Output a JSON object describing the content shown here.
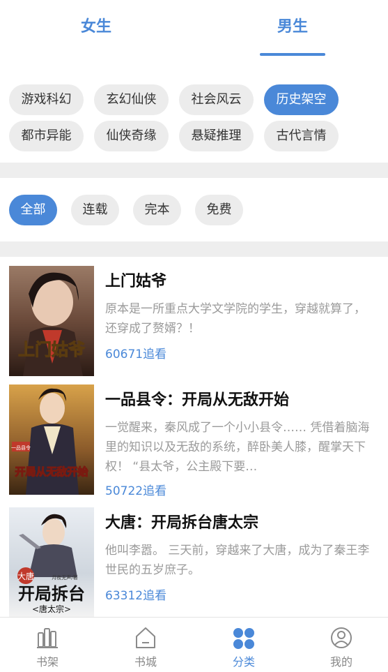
{
  "gender_tabs": {
    "female": "女生",
    "male": "男生",
    "active": "male"
  },
  "genres": [
    "游戏科幻",
    "玄幻仙侠",
    "社会风云",
    "历史架空",
    "都市异能",
    "仙侠奇缘",
    "悬疑推理",
    "古代言情"
  ],
  "genre_active": "历史架空",
  "filters": [
    "全部",
    "连载",
    "完本",
    "免费"
  ],
  "filter_active": "全部",
  "books": [
    {
      "title": "上门姑爷",
      "desc": "原本是一所重点大学文学院的学生，穿越就算了，还穿成了赘婿？！",
      "count": "60671追看",
      "cover_text": "上门姑爷"
    },
    {
      "title": "一品县令：开局从无敌开始",
      "desc": "一觉醒来，秦风成了一个小小县令…… 凭借着脑海里的知识以及无敌的系统，醉卧美人膝，醒掌天下权！ “县太爷，公主殿下要…",
      "count": "50722追看",
      "cover_text": "开局从无敌开始",
      "cover_tag": "一品县令"
    },
    {
      "title": "大唐：开局拆台唐太宗",
      "desc": "他叫李嚣。 三天前，穿越来了大唐，成为了秦王李世民的五岁庶子。",
      "count": "63312追看",
      "cover_text": "开局拆台",
      "cover_tag": "大唐",
      "cover_sub": "<唐太宗>",
      "cover_author": "月夜无声/著"
    }
  ],
  "bottom_nav": [
    {
      "label": "书架",
      "icon": "bookshelf-icon"
    },
    {
      "label": "书城",
      "icon": "home-icon"
    },
    {
      "label": "分类",
      "icon": "category-icon"
    },
    {
      "label": "我的",
      "icon": "profile-icon"
    }
  ],
  "nav_active": "分类",
  "colors": {
    "accent": "#4a88d8",
    "chip_bg": "#ececec",
    "desc": "#9a9a9a"
  }
}
